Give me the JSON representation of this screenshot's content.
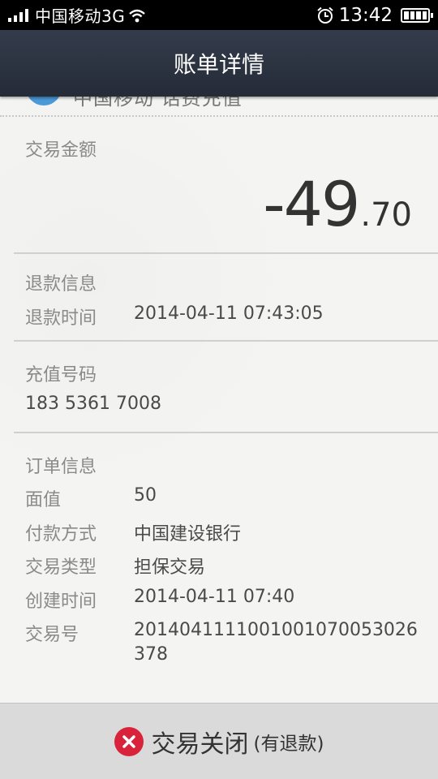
{
  "status_bar": {
    "carrier": "中国移动3G",
    "time": "13:42"
  },
  "title": "账单详情",
  "partial_row_text": "中国移动 话费充值",
  "amount": {
    "label": "交易金额",
    "integer": "-49",
    "decimal": ".70"
  },
  "refund": {
    "section_title": "退款信息",
    "time_label": "退款时间",
    "time_value": "2014-04-11 07:43:05"
  },
  "recharge": {
    "section_title": "充值号码",
    "number": "183 5361 7008"
  },
  "order": {
    "section_title": "订单信息",
    "rows": [
      {
        "label": "面值",
        "value": "50"
      },
      {
        "label": "付款方式",
        "value": "中国建设银行"
      },
      {
        "label": "交易类型",
        "value": "担保交易"
      },
      {
        "label": "创建时间",
        "value": "2014-04-11 07:40"
      },
      {
        "label": "交易号",
        "value": "2014041111001001070053026378"
      }
    ]
  },
  "bottom_status": {
    "main": "交易关闭",
    "sub": "(有退款)",
    "icon_color": "#d8233a"
  },
  "icons": [
    "signal-icon",
    "wifi-icon",
    "alarm-icon",
    "battery-icon",
    "close-icon"
  ]
}
